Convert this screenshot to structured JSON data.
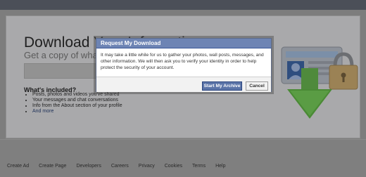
{
  "page": {
    "title": "Download Your Information",
    "subtitle": "Get a copy of what you've shared on Facebook",
    "included_heading": "What's included?",
    "included_items": [
      "Posts, photos and videos you've shared",
      "Your messages and chat conversations",
      "Info from the About section of your profile"
    ],
    "and_more": "And more"
  },
  "dialog": {
    "title": "Request My Download",
    "body": "It may take a little while for us to gather your photos, wall posts, messages, and other information. We will then ask you to verify your identity in order to help protect the security of your account.",
    "primary_label": "Start My Archive",
    "cancel_label": "Cancel"
  },
  "footer": {
    "links": [
      "Create Ad",
      "Create Page",
      "Developers",
      "Careers",
      "Privacy",
      "Cookies",
      "Terms",
      "Help"
    ]
  },
  "colors": {
    "dialog_header": "#6d84b4",
    "primary_button": "#5b74a8",
    "overlay": "#7d7d7d"
  },
  "icons": [
    "id-card-icon",
    "padlock-icon",
    "download-arrow-icon"
  ]
}
